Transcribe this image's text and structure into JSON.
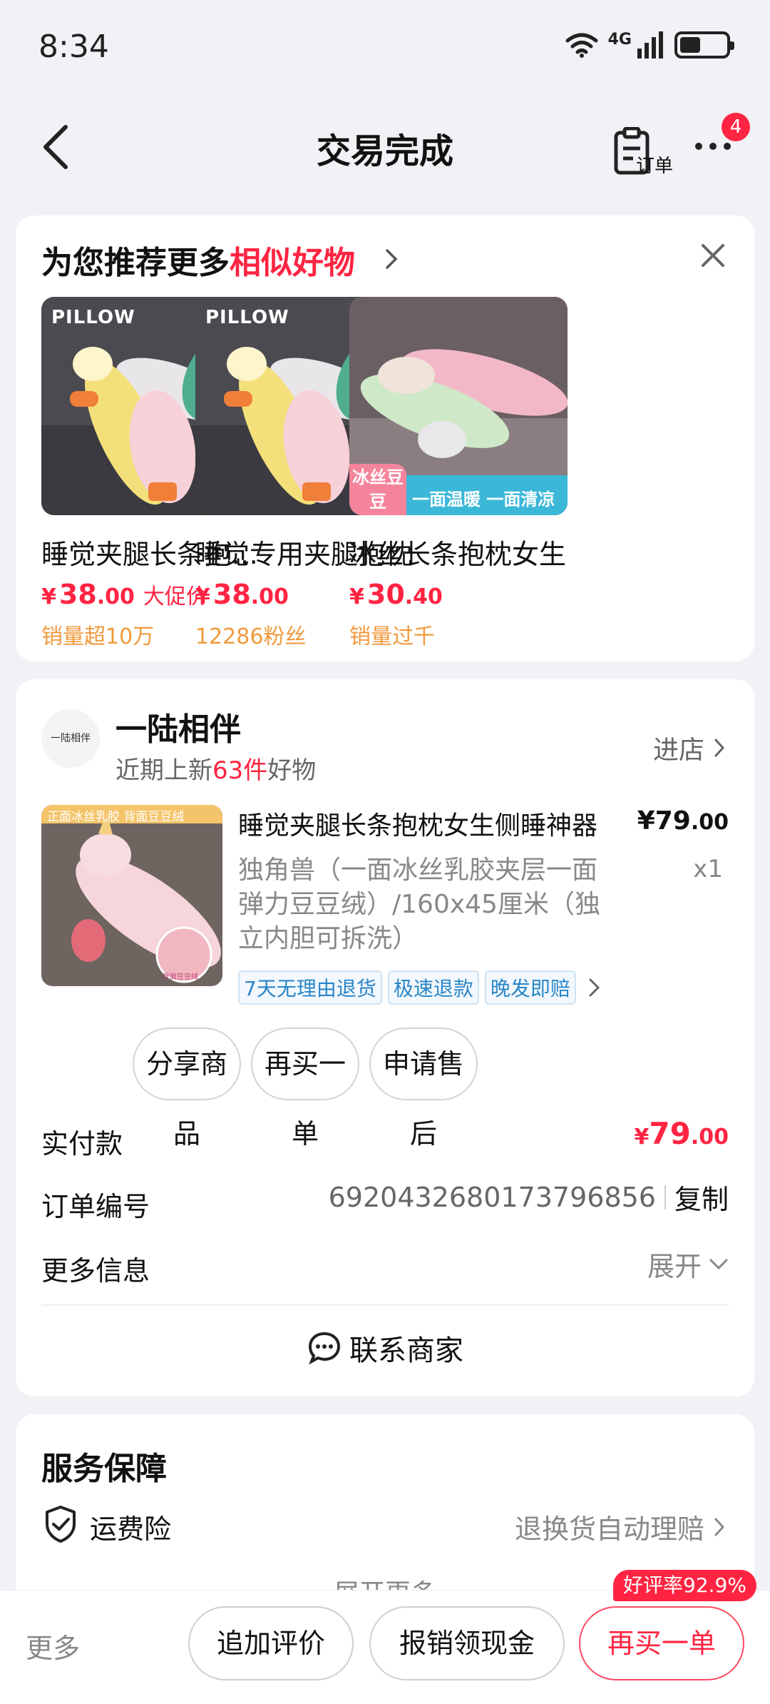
{
  "status_bar": {
    "time": "8:34",
    "network": "4G"
  },
  "nav": {
    "title": "交易完成",
    "order_label": "订单",
    "badge_count": "4"
  },
  "recommend": {
    "title_prefix": "为您推荐更多",
    "title_highlight": "相似好物",
    "products": [
      {
        "name": "睡觉夹腿长条抱枕女生侧睡神器",
        "currency": "¥",
        "price_int": "38",
        "price_dec": ".00",
        "tag": "大促价",
        "sub": "销量超10万",
        "image_text": "PILLOW"
      },
      {
        "name": "睡觉专用夹腿抱枕",
        "currency": "¥",
        "price_int": "38",
        "price_dec": ".00",
        "tag": "",
        "sub": "12286粉丝",
        "image_text": "PILLOW"
      },
      {
        "name": "冰丝长条抱枕女生",
        "currency": "¥",
        "price_int": "30",
        "price_dec": ".40",
        "tag": "",
        "sub": "销量过千",
        "image_badge": "冰丝豆豆",
        "image_banner": "一面温暖 一面清凉"
      }
    ]
  },
  "order": {
    "shop_name": "一陆相伴",
    "shop_logo_text": "一陆相伴",
    "shop_sub_prefix": "近期上新",
    "shop_sub_count": "63件",
    "shop_sub_suffix": "好物",
    "enter_shop": "进店",
    "item": {
      "title": "睡觉夹腿长条抱枕女生侧睡神器",
      "price_int": "¥79",
      "price_dec": ".00",
      "spec": "独角兽（一面冰丝乳胶夹层一面弹力豆豆绒）/160x45厘米（独立内胆可拆洗）",
      "quantity": "x1",
      "image_caption_top": "正面冰丝乳胶 背面豆豆绒",
      "image_caption_bottom": "背面豆豆绒",
      "tags": [
        "7天无理由退货",
        "极速退款",
        "晚发即赔"
      ]
    },
    "actions": [
      "分享商品",
      "再买一单",
      "申请售后"
    ],
    "paid_label": "实付款",
    "paid_currency": "¥",
    "paid_int": "79",
    "paid_dec": ".00",
    "order_no_label": "订单编号",
    "order_no": "6920432680173796856",
    "copy": "复制",
    "more_info_label": "更多信息",
    "expand": "展开",
    "contact": "联系商家"
  },
  "service": {
    "title": "服务保障",
    "item_label": "运费险",
    "item_right": "退换货自动理赔",
    "show_more": "展开更多"
  },
  "bottom_bar": {
    "more": "更多",
    "buttons": [
      "追加评价",
      "报销领现金",
      "再买一单"
    ],
    "rating_badge": "好评率92.9%"
  },
  "colors": {
    "accent": "#ff2442",
    "orange": "#f09a3e",
    "tag_blue": "#2a86c7",
    "background": "#f1f2f6"
  }
}
